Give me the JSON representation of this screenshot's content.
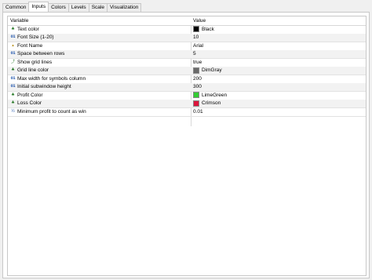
{
  "tabs": [
    {
      "label": "Common"
    },
    {
      "label": "Inputs"
    },
    {
      "label": "Colors"
    },
    {
      "label": "Levels"
    },
    {
      "label": "Scale"
    },
    {
      "label": "Visualization"
    }
  ],
  "table": {
    "header": {
      "variable": "Variable",
      "value": "Value"
    },
    "rows": [
      {
        "icon": "palette-icon",
        "name": "Text color",
        "value": "Black",
        "swatch": "#000000"
      },
      {
        "icon": "integer-icon",
        "name": "Font Size (1-20)",
        "value": "10"
      },
      {
        "icon": "string-icon",
        "name": "Font Name",
        "value": "Arial"
      },
      {
        "icon": "integer-icon",
        "name": "Space between rows",
        "value": "5"
      },
      {
        "icon": "boolean-icon",
        "name": "Show grid lines",
        "value": "true"
      },
      {
        "icon": "palette-icon",
        "name": "Grid line color",
        "value": "DimGray",
        "swatch": "#696969"
      },
      {
        "icon": "integer-icon",
        "name": "Max width for symbols column",
        "value": "200"
      },
      {
        "icon": "integer-icon",
        "name": "Initial subwindow height",
        "value": "300"
      },
      {
        "icon": "palette-icon",
        "name": "Profit Color",
        "value": "LimeGreen",
        "swatch": "#32cd32"
      },
      {
        "icon": "palette-icon",
        "name": "Loss Color",
        "value": "Crimson",
        "swatch": "#dc143c"
      },
      {
        "icon": "double-icon",
        "name": "Minimum profit to count as win",
        "value": "0.01"
      }
    ]
  },
  "icon_glyphs": {
    "color": "♣",
    "num": "01",
    "str": "abc",
    "bool": "⤴",
    "dbl": "½"
  }
}
